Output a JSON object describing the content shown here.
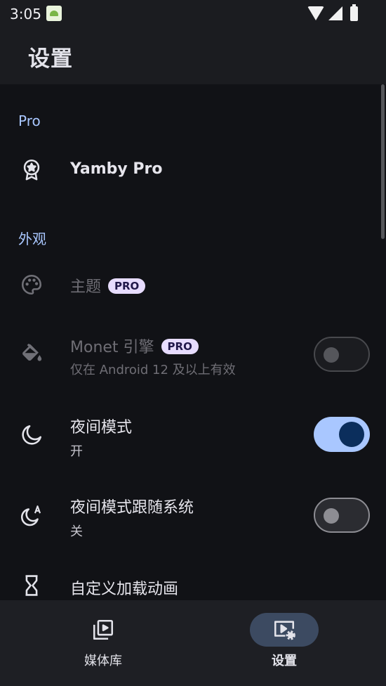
{
  "status_bar": {
    "time": "3:05"
  },
  "app_bar": {
    "title": "设置"
  },
  "sections": {
    "pro": {
      "header": "Pro",
      "yamby_pro": "Yamby Pro"
    },
    "appearance": {
      "header": "外观",
      "theme": {
        "title": "主题",
        "badge": "PRO"
      },
      "monet": {
        "title": "Monet 引擎",
        "badge": "PRO",
        "subtitle": "仅在 Android 12 及以上有效",
        "enabled": false
      },
      "night_mode": {
        "title": "夜间模式",
        "subtitle": "开",
        "enabled": true
      },
      "night_follow_system": {
        "title": "夜间模式跟随系统",
        "subtitle": "关",
        "enabled": false
      },
      "loading_animation": {
        "title": "自定义加载动画"
      }
    }
  },
  "bottom_nav": {
    "items": [
      {
        "label": "媒体库",
        "icon": "video-library-icon",
        "active": false
      },
      {
        "label": "设置",
        "icon": "video-settings-icon",
        "active": true
      }
    ]
  },
  "colors": {
    "accent": "#a9c7ff",
    "background": "#111216",
    "surface": "#1b1c20",
    "badge_bg": "#e7dcff"
  }
}
